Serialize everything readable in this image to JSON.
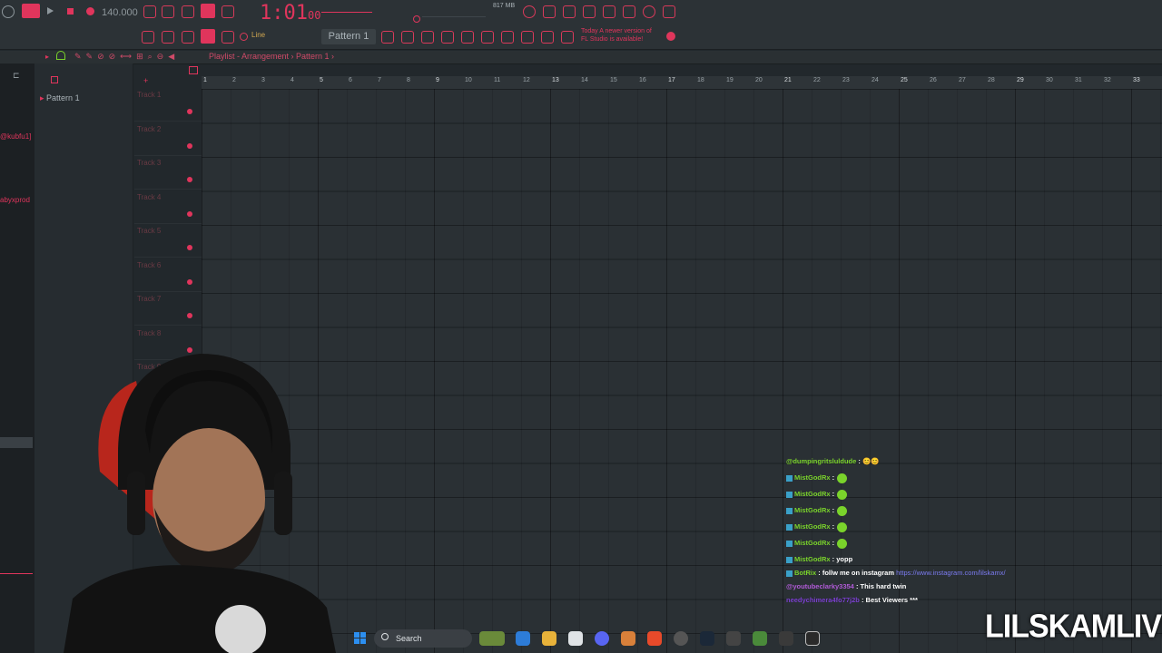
{
  "toolbar": {
    "tempo": "140.000",
    "song_time": "1:01",
    "song_time_sub": "00",
    "cpu": "817 MB",
    "pattern_selector": "Pattern 1",
    "snap_mode": "Line",
    "news_line1": "Today  A newer version of",
    "news_line2": "FL Studio is available!"
  },
  "playlist": {
    "breadcrumb": "Playlist - Arrangement › Pattern 1 ›",
    "pattern_item": "Pattern 1",
    "ruler": [
      "1",
      "2",
      "3",
      "4",
      "5",
      "6",
      "7",
      "8",
      "9",
      "10",
      "11",
      "12",
      "13",
      "14",
      "15",
      "16",
      "17",
      "18",
      "19",
      "20",
      "21",
      "22",
      "23",
      "24",
      "25",
      "26",
      "27",
      "28",
      "29",
      "30",
      "31",
      "32",
      "33"
    ],
    "tracks": [
      "Track 1",
      "Track 2",
      "Track 3",
      "Track 4",
      "Track 5",
      "Track 6",
      "Track 7",
      "Track 8",
      "Track 9"
    ]
  },
  "left_chat": [
    "@kubfu1]",
    "abyxprod"
  ],
  "taskbar": {
    "search": "Search"
  },
  "chat": [
    {
      "name": "@dumpingritsluldude",
      "text": " : 😊😊",
      "color": "#7ad32b",
      "emote": false
    },
    {
      "name": "MistGodRx",
      "text": " :",
      "color": "#7ad32b",
      "emote": true
    },
    {
      "name": "MistGodRx",
      "text": " :",
      "color": "#7ad32b",
      "emote": true
    },
    {
      "name": "MistGodRx",
      "text": " :",
      "color": "#7ad32b",
      "emote": true
    },
    {
      "name": "MistGodRx",
      "text": " :",
      "color": "#7ad32b",
      "emote": true
    },
    {
      "name": "MistGodRx",
      "text": " :",
      "color": "#7ad32b",
      "emote": true
    },
    {
      "name": "MistGodRx",
      "text": " : yopp",
      "color": "#7ad32b",
      "emote": false
    },
    {
      "name": "BotRix",
      "text": " : follw me on instagram ",
      "link": "https://www.instagram.com/lilskamx/",
      "color": "#7ad32b",
      "emote": false
    },
    {
      "name": "@youtubeclarky3354",
      "text": " : This hard twin",
      "color": "#b05ad6",
      "emote": false
    },
    {
      "name": "needychimera4fo77j2b",
      "text": " : Best Viewers ***",
      "color": "#7b3fd0",
      "emote": false
    }
  ],
  "brand": "LILSKAMLIVE",
  "colors": {
    "accent": "#e0355c",
    "chat_green": "#7ad32b",
    "link": "#7b7bf0"
  }
}
